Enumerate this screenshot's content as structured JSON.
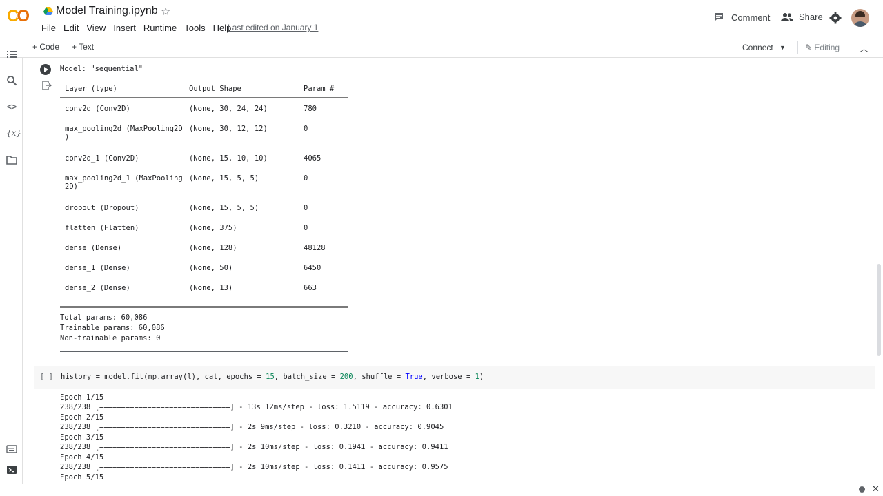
{
  "header": {
    "title": "Model Training.ipynb",
    "menu": [
      "File",
      "Edit",
      "View",
      "Insert",
      "Runtime",
      "Tools",
      "Help"
    ],
    "last_edited": "Last edited on January 1",
    "comment_label": "Comment",
    "share_label": "Share"
  },
  "toolbar": {
    "code_label": "+ Code",
    "text_label": "+ Text",
    "connect_label": "Connect",
    "editing_label": "Editing"
  },
  "output": {
    "model_line": "Model: \"sequential\"",
    "header_cols": [
      "Layer (type)",
      "Output Shape",
      "Param #"
    ],
    "rows": [
      {
        "layer": "conv2d (Conv2D)",
        "shape": "(None, 30, 24, 24)",
        "params": "780"
      },
      {
        "layer": "max_pooling2d (MaxPooling2D\n)",
        "shape": "(None, 30, 12, 12)",
        "params": "0"
      },
      {
        "layer": "conv2d_1 (Conv2D)",
        "shape": "(None, 15, 10, 10)",
        "params": "4065"
      },
      {
        "layer": "max_pooling2d_1 (MaxPooling\n2D)",
        "shape": "(None, 15, 5, 5)",
        "params": "0"
      },
      {
        "layer": "dropout (Dropout)",
        "shape": "(None, 15, 5, 5)",
        "params": "0"
      },
      {
        "layer": "flatten (Flatten)",
        "shape": "(None, 375)",
        "params": "0"
      },
      {
        "layer": "dense (Dense)",
        "shape": "(None, 128)",
        "params": "48128"
      },
      {
        "layer": "dense_1 (Dense)",
        "shape": "(None, 50)",
        "params": "6450"
      },
      {
        "layer": "dense_2 (Dense)",
        "shape": "(None, 13)",
        "params": "663"
      }
    ],
    "total_params": "Total params: 60,086",
    "trainable_params": "Trainable params: 60,086",
    "non_trainable_params": "Non-trainable params: 0"
  },
  "code_cell": {
    "brackets": "[ ]",
    "code": {
      "p1": "history = model.fit(np.array(l), cat, epochs = ",
      "n1": "15",
      "p2": ", batch_size = ",
      "n2": "200",
      "p3": ", shuffle = ",
      "kw": "True",
      "p4": ", verbose = ",
      "n3": "1",
      "p5": ")"
    }
  },
  "training_log": [
    "Epoch 1/15",
    "238/238 [==============================] - 13s 12ms/step - loss: 1.5119 - accuracy: 0.6301",
    "Epoch 2/15",
    "238/238 [==============================] - 2s 9ms/step - loss: 0.3210 - accuracy: 0.9045",
    "Epoch 3/15",
    "238/238 [==============================] - 2s 10ms/step - loss: 0.1941 - accuracy: 0.9411",
    "Epoch 4/15",
    "238/238 [==============================] - 2s 10ms/step - loss: 0.1411 - accuracy: 0.9575",
    "Epoch 5/15"
  ]
}
